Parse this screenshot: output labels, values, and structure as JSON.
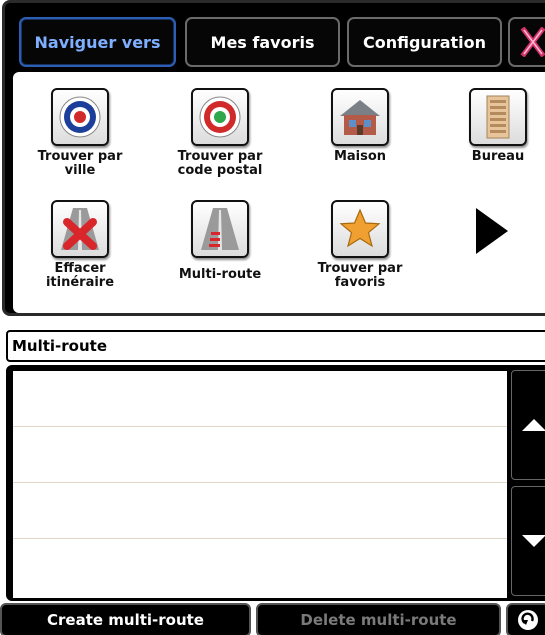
{
  "tabs": [
    {
      "label": "Naviguer vers",
      "active": true
    },
    {
      "label": "Mes favoris",
      "active": false
    },
    {
      "label": "Configuration",
      "active": false
    }
  ],
  "close_icon": "close-x-icon",
  "grid": [
    {
      "label": "Trouver par ville",
      "icon": "target-blue-icon"
    },
    {
      "label": "Trouver par code postal",
      "icon": "target-green-icon"
    },
    {
      "label": "Maison",
      "icon": "house-icon"
    },
    {
      "label": "Bureau",
      "icon": "office-building-icon"
    },
    {
      "label": "Effacer itinéraire",
      "icon": "clear-route-icon"
    },
    {
      "label": "Multi-route",
      "icon": "multi-route-icon"
    },
    {
      "label": "Trouver par favoris",
      "icon": "star-icon"
    }
  ],
  "multiroute": {
    "title": "Multi-route",
    "rows": [
      "",
      "",
      "",
      ""
    ]
  },
  "buttons": {
    "create": "Create multi-route",
    "delete": "Delete multi-route"
  },
  "colors": {
    "active_tab_text": "#7fb0ff",
    "active_tab_border": "#2c5fb4",
    "close_icon": "#d0336a",
    "disabled_text": "#7a7a7a"
  }
}
